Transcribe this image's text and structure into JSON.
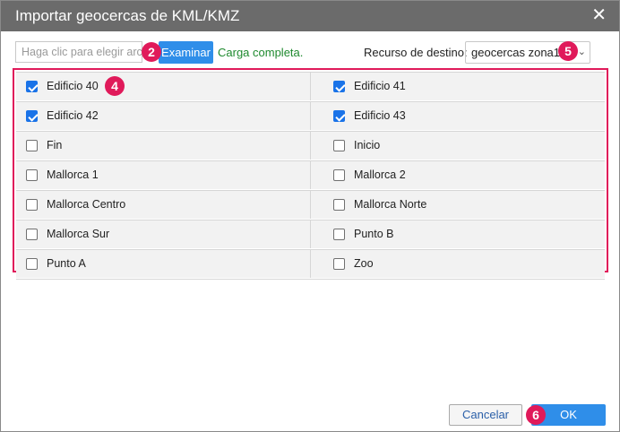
{
  "dialog": {
    "title": "Importar geocercas de KML/KMZ",
    "close_symbol": "✕"
  },
  "toolbar": {
    "file_placeholder": "Haga clic para elegir arc",
    "browse_label": "Examinar",
    "status_text": "Carga completa.",
    "resource_label": "Recurso de destino:",
    "resource_value": "geocercas zona1"
  },
  "geofences": [
    {
      "name": "Edificio 40",
      "checked": true
    },
    {
      "name": "Edificio 41",
      "checked": true
    },
    {
      "name": "Edificio 42",
      "checked": true
    },
    {
      "name": "Edificio 43",
      "checked": true
    },
    {
      "name": "Fin",
      "checked": false
    },
    {
      "name": "Inicio",
      "checked": false
    },
    {
      "name": "Mallorca 1",
      "checked": false
    },
    {
      "name": "Mallorca 2",
      "checked": false
    },
    {
      "name": "Mallorca Centro",
      "checked": false
    },
    {
      "name": "Mallorca Norte",
      "checked": false
    },
    {
      "name": "Mallorca Sur",
      "checked": false
    },
    {
      "name": "Punto B",
      "checked": false
    },
    {
      "name": "Punto A",
      "checked": false
    },
    {
      "name": "Zoo",
      "checked": false
    }
  ],
  "footer": {
    "cancel_label": "Cancelar",
    "ok_label": "OK"
  },
  "badges": {
    "browse": "2",
    "list": "4",
    "resource": "5",
    "ok": "6"
  },
  "colors": {
    "accent": "#2f8ee9",
    "highlight": "#e01a5a",
    "success": "#1f8a2f",
    "titlebar": "#6b6b6b"
  }
}
